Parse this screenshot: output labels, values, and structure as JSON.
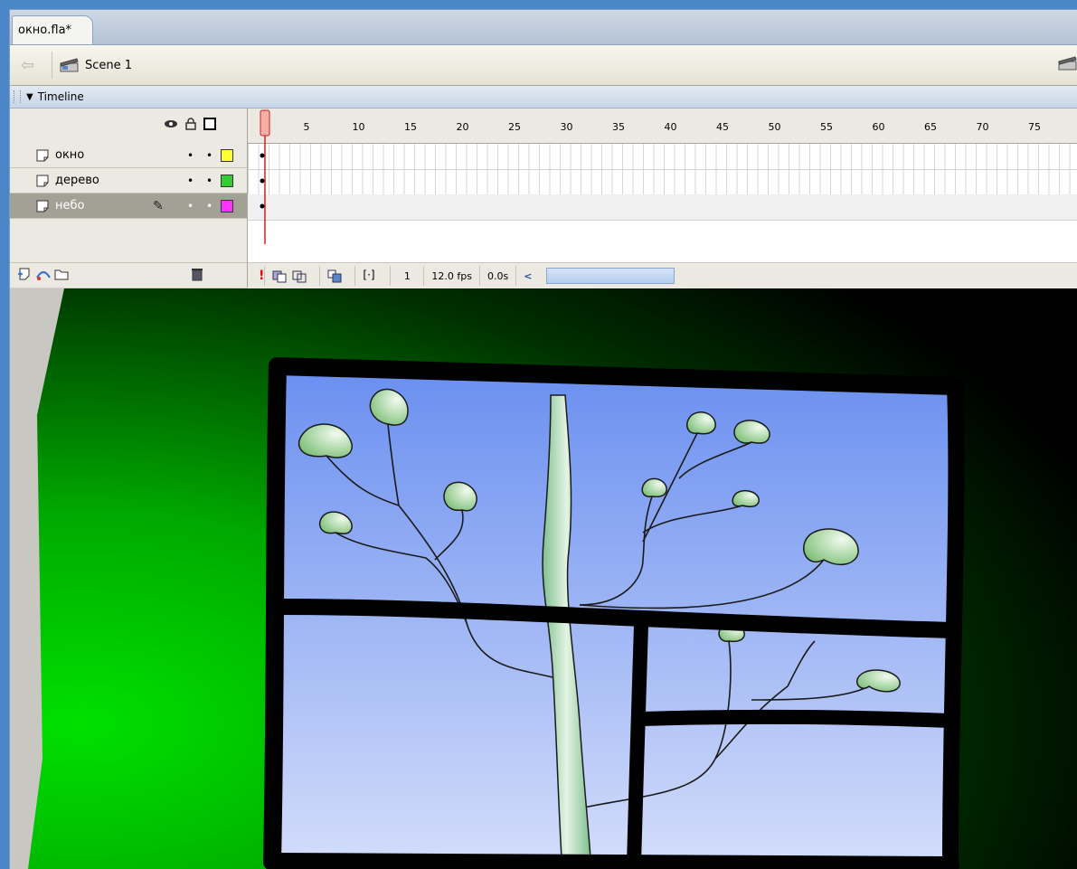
{
  "document": {
    "tab_label": "окно.fla*"
  },
  "editbar": {
    "scene_label": "Scene 1",
    "back_icon": "back-arrow-icon",
    "scene_icon": "clapperboard-icon"
  },
  "timeline": {
    "panel_title": "Timeline",
    "layers": [
      {
        "name": "окно",
        "color": "#ffff33",
        "selected": false
      },
      {
        "name": "дерево",
        "color": "#33cc33",
        "selected": false
      },
      {
        "name": "небо",
        "color": "#ff33ff",
        "selected": true
      }
    ],
    "ruler_numbers": [
      "5",
      "10",
      "15",
      "20",
      "25",
      "30",
      "35",
      "40",
      "45",
      "50",
      "55",
      "60",
      "65",
      "70",
      "75"
    ],
    "status": {
      "current_frame": "1",
      "frame_rate": "12.0 fps",
      "elapsed": "0.0s",
      "scroll_left": "<"
    }
  },
  "stage": {
    "sky_colors": [
      "#6a8ff0",
      "#d2dcfa"
    ],
    "bg_colors": [
      "#00e000",
      "#000000"
    ],
    "frame_color": "#000000",
    "leaf_color": "#a8d8a0"
  }
}
